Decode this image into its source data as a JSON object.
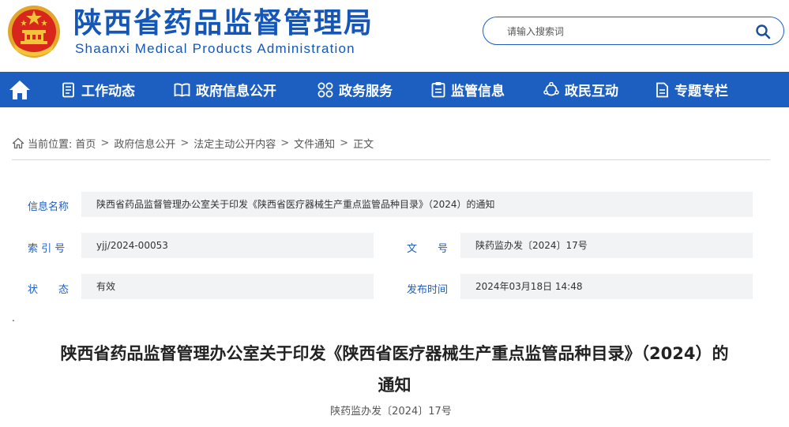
{
  "header": {
    "title_cn": "陕西省药品监督管理局",
    "title_en": "Shaanxi Medical Products Administration",
    "search_placeholder": "请输入搜索词"
  },
  "nav": {
    "items": [
      {
        "label": "工作动态",
        "icon": "document-list-icon"
      },
      {
        "label": "政府信息公开",
        "icon": "open-book-icon"
      },
      {
        "label": "政务服务",
        "icon": "four-circles-icon"
      },
      {
        "label": "监管信息",
        "icon": "clipboard-icon"
      },
      {
        "label": "政民互动",
        "icon": "interaction-icon"
      },
      {
        "label": "专题专栏",
        "icon": "file-icon"
      }
    ]
  },
  "breadcrumb": {
    "prefix": "当前位置:",
    "items": [
      "首页",
      "政府信息公开",
      "法定主动公开内容",
      "文件通知",
      "正文"
    ]
  },
  "info": {
    "name_label": "信息名称",
    "name_value": "陕西省药品监督管理办公室关于印发《陕西省医疗器械生产重点监管品种目录》（2024）的通知",
    "index_label": "索 引 号",
    "index_value": "yjj/2024-00053",
    "docno_label": "文　　号",
    "docno_value": "陕药监办发〔2024〕17号",
    "status_label": "状　　态",
    "status_value": "有效",
    "date_label": "发布时间",
    "date_value": "2024年03月18日 14:48"
  },
  "document": {
    "dot": ".",
    "title_line1": "陕西省药品监督管理办公室关于印发《陕西省医疗器械生产重点监管品种目录》（2024）的",
    "title_line2": "通知",
    "doc_number": "陕药监办发〔2024〕17号"
  },
  "colors": {
    "brand_blue": "#1d5fc1",
    "emblem_red": "#d8261c",
    "emblem_gold": "#f3c43a"
  }
}
